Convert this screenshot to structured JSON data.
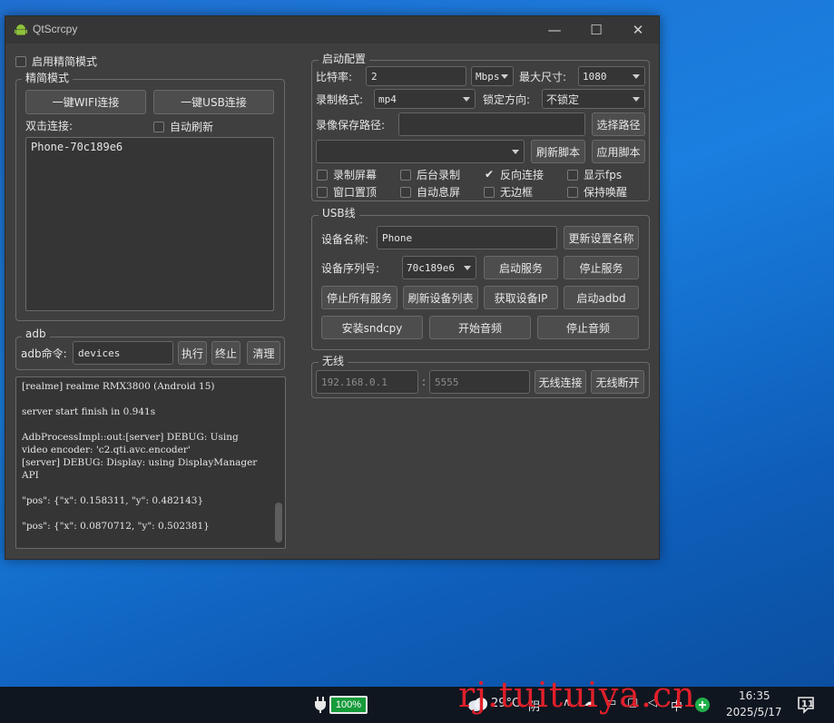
{
  "window": {
    "title": "QtScrcpy",
    "controls": {
      "minimize": "—",
      "maximize": "☐",
      "close": "✕"
    }
  },
  "left": {
    "simple_mode_checkbox": "启用精简模式",
    "simple_group": {
      "title": "精简模式",
      "wifi_button": "一键WIFI连接",
      "usb_button": "一键USB连接",
      "double_click_label": "双击连接:",
      "auto_refresh_checkbox": "自动刷新",
      "devices": [
        "Phone-70c189e6"
      ]
    },
    "adb_group": {
      "title": "adb",
      "command_label": "adb命令:",
      "command_value": "devices",
      "execute_button": "执行",
      "terminate_button": "终止",
      "clear_button": "清理"
    },
    "log_lines": [
      "[realme] realme RMX3800 (Android 15)",
      "",
      "server start finish in 0.941s",
      "",
      "AdbProcessImpl::out:[server] DEBUG: Using video encoder: 'c2.qti.avc.encoder'",
      "[server] DEBUG: Display: using DisplayManager API",
      "",
      "\"pos\": {\"x\": 0.158311, \"y\": 0.482143}",
      "",
      "\"pos\": {\"x\": 0.0870712, \"y\": 0.502381}"
    ]
  },
  "config_group": {
    "title": "启动配置",
    "bitrate_label": "比特率:",
    "bitrate_value": "2",
    "bitrate_unit": "Mbps",
    "max_size_label": "最大尺寸:",
    "max_size_value": "1080",
    "record_format_label": "录制格式:",
    "record_format_value": "mp4",
    "lock_orientation_label": "锁定方向:",
    "lock_orientation_value": "不锁定",
    "record_path_label": "录像保存路径:",
    "record_path_value": "",
    "select_path_button": "选择路径",
    "script_value": "",
    "refresh_script_button": "刷新脚本",
    "apply_script_button": "应用脚本",
    "checkboxes": [
      {
        "label": "录制屏幕",
        "checked": false
      },
      {
        "label": "后台录制",
        "checked": false
      },
      {
        "label": "反向连接",
        "checked": true
      },
      {
        "label": "显示fps",
        "checked": false
      },
      {
        "label": "窗口置顶",
        "checked": false
      },
      {
        "label": "自动息屏",
        "checked": false
      },
      {
        "label": "无边框",
        "checked": false
      },
      {
        "label": "保持唤醒",
        "checked": false
      }
    ]
  },
  "usb_group": {
    "title": "USB线",
    "device_name_label": "设备名称:",
    "device_name_value": "Phone",
    "update_name_button": "更新设置名称",
    "serial_label": "设备序列号:",
    "serial_value": "70c189e6",
    "start_service_button": "启动服务",
    "stop_service_button": "停止服务",
    "stop_all_button": "停止所有服务",
    "refresh_devices_button": "刷新设备列表",
    "get_ip_button": "获取设备IP",
    "start_adbd_button": "启动adbd",
    "install_sndcpy_button": "安装sndcpy",
    "start_audio_button": "开始音频",
    "stop_audio_button": "停止音频"
  },
  "wireless_group": {
    "title": "无线",
    "ip_placeholder": "192.168.0.1",
    "port_separator": ":",
    "port_placeholder": "5555",
    "connect_button": "无线连接",
    "disconnect_button": "无线断开"
  },
  "taskbar": {
    "battery": "100%",
    "weather_temp": "29°C",
    "weather_text": "阴",
    "ime": "中",
    "time": "16:35",
    "date": "2025/5/17",
    "notification_count": "11"
  },
  "watermark": "rj.tuituiya.cn",
  "colors": {
    "window_bg": "#3f3f3f",
    "titlebar_bg": "#363636",
    "watermark": "#e0202a",
    "battery": "#169b3a"
  }
}
